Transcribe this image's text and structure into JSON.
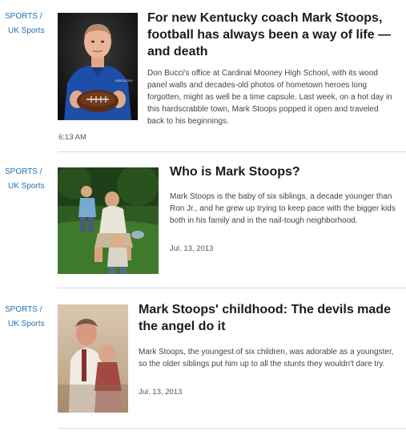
{
  "articles": [
    {
      "section": "SPORTS",
      "separator": "/",
      "subsection": "UK Sports",
      "headline": "For new Kentucky coach Mark Stoops, football has always been a way of life — and death",
      "summary": "Don Bucci's office at Cardinal Mooney High School, with its wood panel walls and decades-old photos of hometown heroes long forgotten, might as well be a time capsule. Last week, on a hot day in this hardscrabble town, Mark Stoops popped it open and traveled back to his beginnings.",
      "timestamp": "6:13 AM",
      "jersey_text": "KENTUCKY"
    },
    {
      "section": "SPORTS",
      "separator": "/",
      "subsection": "UK Sports",
      "headline": "Who is Mark Stoops?",
      "summary": "Mark Stoops is the baby of six siblings, a decade younger than Ron Jr., and he grew up trying to keep pace with the bigger kids both in his family and in the nail-tough neighborhood.",
      "timestamp": "Jul. 13, 2013"
    },
    {
      "section": "SPORTS",
      "separator": "/",
      "subsection": "UK Sports",
      "headline": "Mark Stoops' childhood: The devils made the angel do it",
      "summary": "Mark Stoops, the youngest of six children, was adorable as a youngster, so the older siblings put him up to all the stunts they wouldn't dare try.",
      "timestamp": "Jul. 13, 2013"
    }
  ],
  "colors": {
    "link": "#1f6fb2",
    "headline": "#1b1b1b",
    "body": "#444444",
    "divider": "#d9d9d9"
  }
}
